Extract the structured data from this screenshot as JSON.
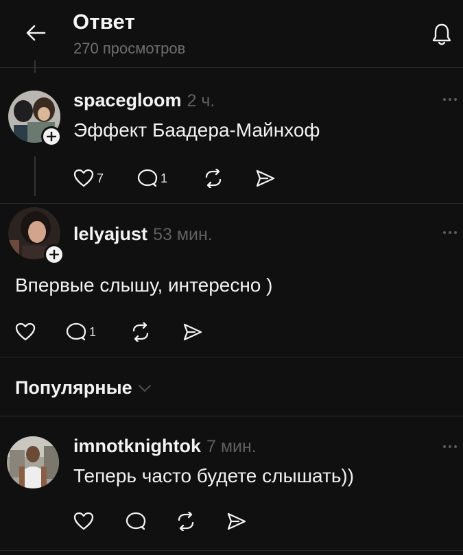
{
  "header": {
    "title": "Ответ",
    "subtitle": "270 просмотров",
    "back_icon": "arrow-left-icon",
    "bell_icon": "bell-icon"
  },
  "comments": [
    {
      "username": "spacegloom",
      "time": "2 ч.",
      "text": "Эффект Баадера-Майнхоф",
      "likes": "7",
      "replies": "1"
    },
    {
      "username": "lelyajust",
      "time": "53 мин.",
      "text": "Впервые слышу, интересно )",
      "likes": "",
      "replies": "1"
    },
    {
      "username": "imnotknightok",
      "time": "7 мин.",
      "text": "Теперь часто будете слышать))",
      "likes": "",
      "replies": ""
    }
  ],
  "section": {
    "label": "Популярные"
  },
  "colors": {
    "background": "#101010",
    "text": "#f3f3f3",
    "muted": "#6e6e6e",
    "divider": "#2a2a2a"
  }
}
